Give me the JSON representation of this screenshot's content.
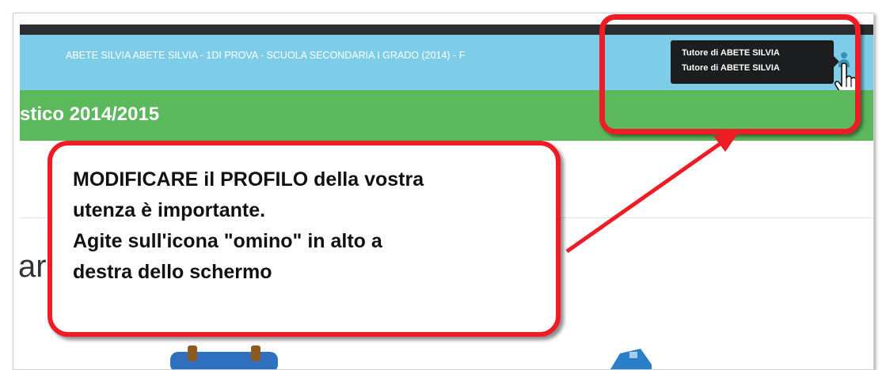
{
  "header": {
    "user_line": "ABETE SILVIA  ABETE SILVIA - 1DI PROVA - SCUOLA SECONDARIA I GRADO (2014) - F",
    "year_title": "stico 2014/2015"
  },
  "tooltip": {
    "line1": "Tutore di ABETE SILVIA",
    "line2": "Tutore di ABETE SILVIA"
  },
  "content": {
    "partial_heading": "ar"
  },
  "callout": {
    "lines": [
      "MODIFICARE il PROFILO della vostra",
      "utenza è importante.",
      "Agite sull'icona \"omino\" in alto a",
      "destra dello schermo"
    ]
  },
  "colors": {
    "header_blue": "#7ecde8",
    "header_green": "#5cb85c",
    "annotation_red": "#ee1c24",
    "tooltip_bg": "#1c1d1f"
  },
  "icons": [
    "user-profile-icon",
    "hand-pointer-cursor-icon",
    "calendar-icon",
    "blue-app-icon"
  ]
}
